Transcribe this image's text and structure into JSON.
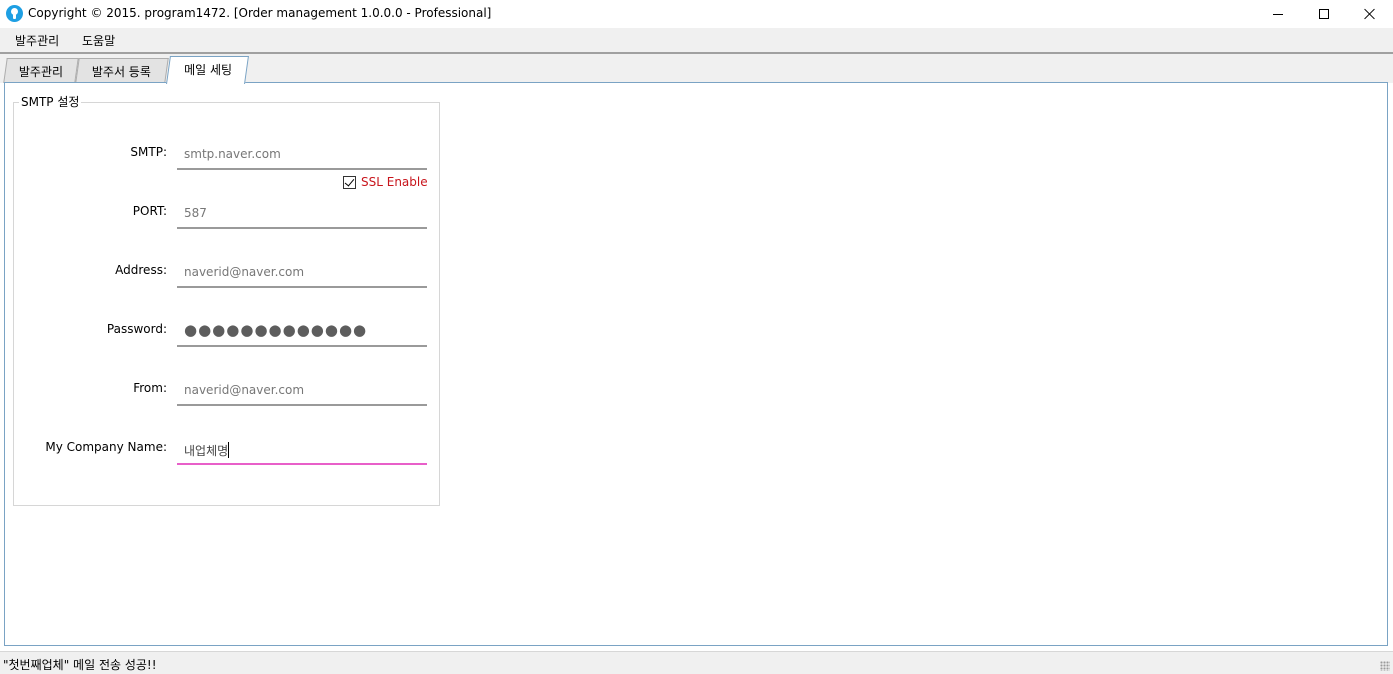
{
  "window": {
    "title": "Copyright © 2015. program1472. [Order management 1.0.0.0 - Professional]"
  },
  "menu": {
    "items": [
      "발주관리",
      "도움말"
    ]
  },
  "tabs": {
    "items": [
      "발주관리",
      "발주서 등록",
      "메일 세팅"
    ],
    "active": "메일 세팅"
  },
  "smtp_group": {
    "title": "SMTP 설정",
    "fields": {
      "smtp": {
        "label": "SMTP:",
        "value": "smtp.naver.com"
      },
      "port": {
        "label": "PORT:",
        "value": "587"
      },
      "address": {
        "label": "Address:",
        "value": "naverid@naver.com"
      },
      "password": {
        "label": "Password:",
        "value": "●●●●●●●●●●●●●"
      },
      "from": {
        "label": "From:",
        "value": "naverid@naver.com"
      },
      "company": {
        "label": "My Company Name:",
        "value": "내업체명"
      }
    },
    "ssl": {
      "label": "SSL Enable",
      "checked": true
    }
  },
  "status": {
    "text": "\"첫번째업체\" 메일 전송 성공!!"
  },
  "colors": {
    "accent_focus": "#e85fc9",
    "ssl_label": "#c8151c",
    "tab_border": "#7aa3c4"
  }
}
